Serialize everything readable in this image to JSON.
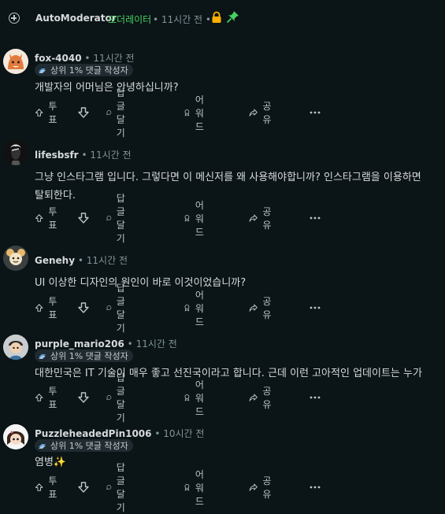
{
  "header": {
    "username": "AutoModerator",
    "moderator_label": "모더레이터",
    "time": "• 11시간 전 •"
  },
  "actions": {
    "upvote": "투표",
    "reply": "답글 달기",
    "award": "어워드",
    "share": "공유"
  },
  "comments": [
    {
      "username": "fox-4040",
      "dot": "•",
      "time": "11시간 전",
      "flair": "상위 1% 댓글 작성자",
      "lines": [
        "개발자의 어머님은 안녕하십니까?"
      ]
    },
    {
      "username": "lifesbsfr",
      "dot": "•",
      "time": "11시간 전",
      "flair": "",
      "lines": [
        "그냥 인스타그램 입니다. 그렇다면 이 메신저를 왜 사용해야합니까? 인스타그램을 이용하면",
        "탈퇴한다."
      ]
    },
    {
      "username": "Genehy",
      "dot": "•",
      "time": "11시간 전",
      "flair": "",
      "lines": [
        "UI 이상한 디자인의 원인이 바로 이것이었습니까?"
      ]
    },
    {
      "username": "purple_mario206",
      "dot": "•",
      "time": "11시간 전",
      "flair": "상위 1% 댓글 작성자",
      "lines": [
        "대한민국은 IT 기술이 매우 좋고 선진국이라고 합니다. 근데 이런 고아적인 업데이트는 누가"
      ]
    },
    {
      "username": "PuzzleheadedPin1006",
      "dot": "•",
      "time": "10시간 전",
      "flair": "상위 1% 댓글 작성자",
      "lines": [
        "염병✨"
      ]
    }
  ],
  "colors": {
    "background": "#0b1416",
    "moderator": "#46d160",
    "muted": "#82959b",
    "lock": "#ffb000",
    "pin": "#46d160",
    "flair_bg": "#1f2b30"
  }
}
